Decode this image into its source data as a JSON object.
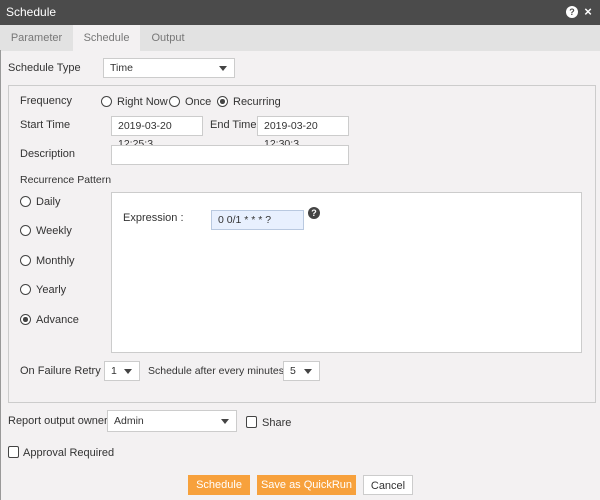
{
  "window": {
    "title": "Schedule",
    "help_icon": "?",
    "close_icon": "×"
  },
  "tabs": [
    {
      "label": "Parameter"
    },
    {
      "label": "Schedule",
      "active": true
    },
    {
      "label": "Output"
    }
  ],
  "schedule_type": {
    "label": "Schedule Type",
    "value": "Time"
  },
  "frequency": {
    "label": "Frequency",
    "options": [
      {
        "label": "Right Now",
        "checked": false
      },
      {
        "label": "Once",
        "checked": false
      },
      {
        "label": "Recurring",
        "checked": true
      }
    ]
  },
  "start_time": {
    "label": "Start Time",
    "value": "2019-03-20 12:25:3"
  },
  "end_time": {
    "label": "End Time",
    "value": "2019-03-20 12:30:3"
  },
  "description": {
    "label": "Description",
    "value": ""
  },
  "recurrence": {
    "label": "Recurrence Pattern",
    "options": [
      {
        "label": "Daily",
        "checked": false
      },
      {
        "label": "Weekly",
        "checked": false
      },
      {
        "label": "Monthly",
        "checked": false
      },
      {
        "label": "Yearly",
        "checked": false
      },
      {
        "label": "Advance",
        "checked": true
      }
    ],
    "expression_label": "Expression :",
    "expression_value": "0 0/1 * * * ?",
    "help_icon": "?"
  },
  "retry": {
    "label": "On Failure Retry",
    "value": "1",
    "minutes_label": "Schedule after every minutes",
    "minutes_value": "5"
  },
  "owner": {
    "label": "Report output owner",
    "value": "Admin",
    "share_label": "Share",
    "share_checked": false
  },
  "approval": {
    "label": "Approval Required",
    "checked": false
  },
  "buttons": {
    "schedule": "Schedule",
    "quickrun": "Save as QuickRun",
    "cancel": "Cancel"
  },
  "colors": {
    "accent": "#f7a13c",
    "titlebar": "#4b4b4b"
  }
}
